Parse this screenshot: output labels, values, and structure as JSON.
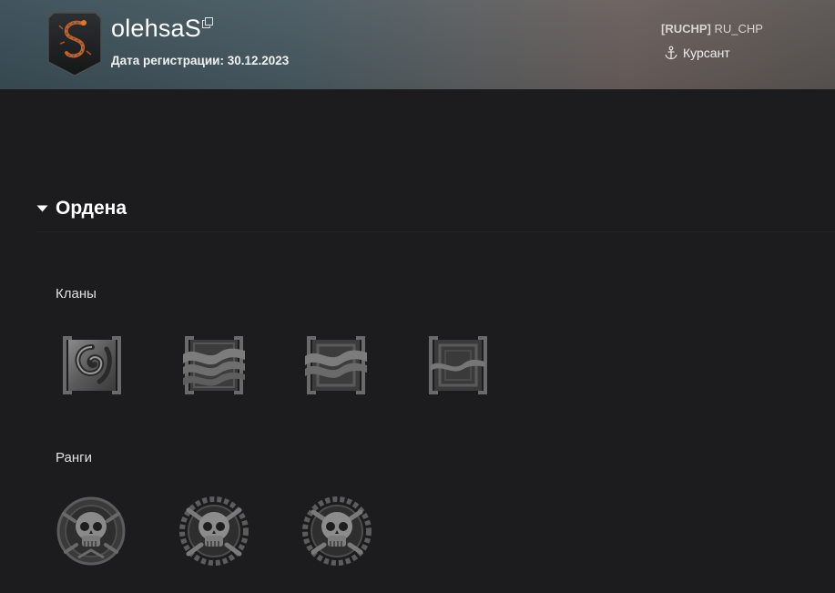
{
  "profile": {
    "username": "olehsaS",
    "registration_label": "Дата регистрации: 30.12.2023",
    "clan_tag": "[RUCHP]",
    "clan_name": "RU_CHP",
    "clan_rank": "Курсант"
  },
  "orders_section": {
    "title": "Ордена",
    "groups": [
      {
        "label": "Кланы",
        "badges": [
          "spiral-emblem",
          "three-waves-emblem",
          "two-waves-emblem",
          "one-wave-emblem"
        ]
      },
      {
        "label": "Ранги",
        "badges": [
          "skull-bones-medal",
          "skull-chain-medal",
          "skull-chain-medal"
        ]
      }
    ]
  }
}
